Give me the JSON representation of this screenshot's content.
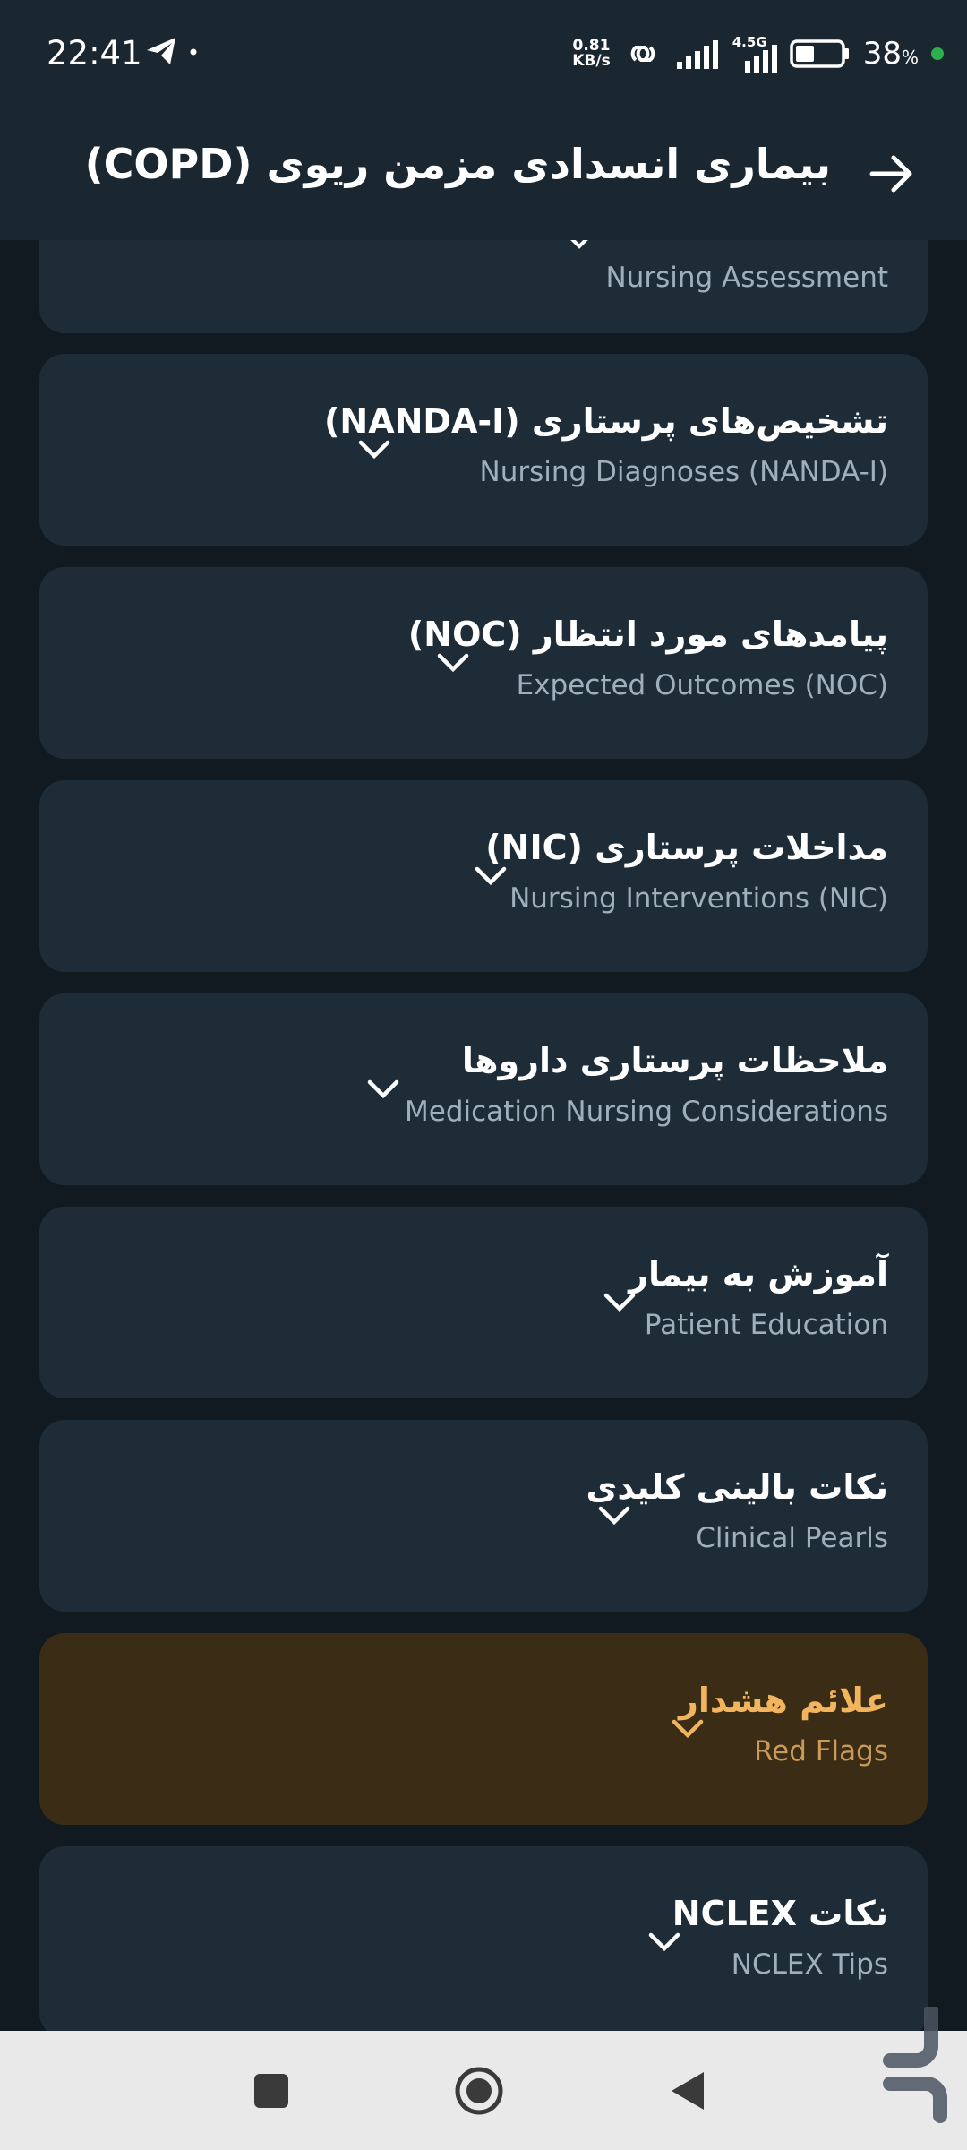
{
  "status_bar": {
    "time": "22:41",
    "net_speed_value": "0.81",
    "net_speed_unit": "KB/s",
    "network_type": "4.5G",
    "battery_percent": "38",
    "battery_percent_sign": "%",
    "icons": [
      "telegram-icon",
      "dot-icon",
      "hotspot-link-icon",
      "signal-icon",
      "signal-icon",
      "battery-icon"
    ]
  },
  "app_bar": {
    "title": "بیماری انسدادی مزمن ریوی (COPD)",
    "back_icon": "arrow-right-icon"
  },
  "sections": [
    {
      "title": "",
      "subtitle": "Nursing Assessment",
      "state": "normal"
    },
    {
      "title": "تشخیص‌های پرستاری (NANDA-I)",
      "subtitle": "Nursing Diagnoses (NANDA-I)",
      "state": "normal"
    },
    {
      "title": "پیامدهای مورد انتظار (NOC)",
      "subtitle": "Expected Outcomes (NOC)",
      "state": "normal"
    },
    {
      "title": "مداخلات پرستاری (NIC)",
      "subtitle": "Nursing Interventions (NIC)",
      "state": "normal"
    },
    {
      "title": "ملاحظات پرستاری داروها",
      "subtitle": "Medication Nursing Considerations",
      "state": "normal"
    },
    {
      "title": "آموزش به بیمار",
      "subtitle": "Patient Education",
      "state": "normal"
    },
    {
      "title": "نکات بالینی کلیدی",
      "subtitle": "Clinical Pearls",
      "state": "normal"
    },
    {
      "title": "علائم هشدار",
      "subtitle": "Red Flags",
      "state": "warning"
    },
    {
      "title": "نکات NCLEX",
      "subtitle": "NCLEX Tips",
      "state": "normal"
    }
  ],
  "colors": {
    "background": "#101a20",
    "card": "#1e2c38",
    "warning_card": "#3a2c15",
    "warning_text": "#f3b45e",
    "nav_bar": "#e9e9e9"
  },
  "nav_bar": {
    "icons": [
      "recent-apps-square-icon",
      "home-circle-icon",
      "back-triangle-icon"
    ]
  }
}
